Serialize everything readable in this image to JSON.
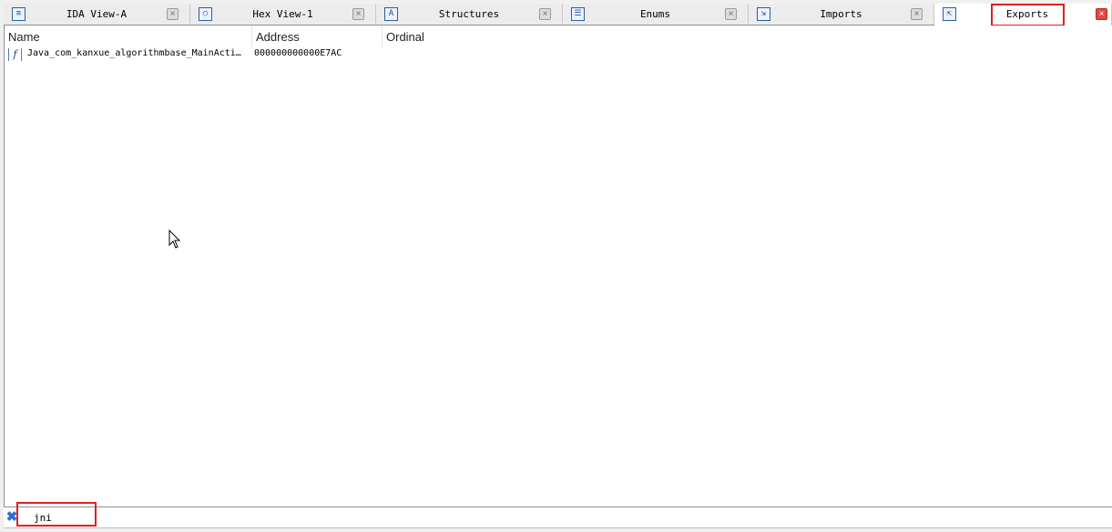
{
  "tabs": [
    {
      "label": "IDA View-A",
      "icon": "ida-view-icon",
      "glyph": "≡",
      "close": "×",
      "active": false
    },
    {
      "label": "Hex View-1",
      "icon": "hex-view-icon",
      "glyph": "○",
      "close": "×",
      "active": false
    },
    {
      "label": "Structures",
      "icon": "structures-icon",
      "glyph": "A",
      "close": "×",
      "active": false
    },
    {
      "label": "Enums",
      "icon": "enums-icon",
      "glyph": "☰",
      "close": "×",
      "active": false
    },
    {
      "label": "Imports",
      "icon": "imports-icon",
      "glyph": "⇲",
      "close": "×",
      "active": false
    },
    {
      "label": "Exports",
      "icon": "exports-icon",
      "glyph": "⇱",
      "close": "×",
      "active": true
    }
  ],
  "table": {
    "columns": [
      "Name",
      "Address",
      "Ordinal"
    ],
    "rows": [
      {
        "icon": "function-icon",
        "glyph": "f",
        "name": "Java_com_kanxue_algorithmbase_MainActi…",
        "address": "000000000000E7AC",
        "ordinal": ""
      }
    ]
  },
  "filter": {
    "value": "jni",
    "clear_glyph": "✖"
  },
  "colors": {
    "highlight": "#e02020",
    "active_close": "#e04a3a",
    "accent": "#2f6fd1"
  }
}
